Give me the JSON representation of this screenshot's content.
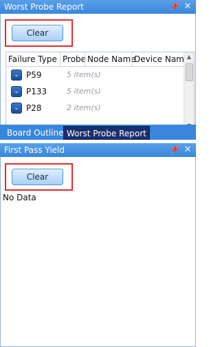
{
  "panels": {
    "worst_probe": {
      "title": "Worst Probe Report",
      "pin_icon": "pin-icon",
      "close_icon": "close-icon",
      "clear_label": "Clear",
      "columns": [
        "Failure Type",
        "Probe",
        "Node Name",
        "Device Name"
      ],
      "rows": [
        {
          "label": "P59",
          "count": "5 item(s)"
        },
        {
          "label": "P133",
          "count": "5 item(s)"
        },
        {
          "label": "P28",
          "count": "2 item(s)"
        }
      ]
    },
    "first_pass_yield": {
      "title": "First Pass Yield",
      "pin_icon": "pin-icon",
      "close_icon": "close-icon",
      "clear_label": "Clear",
      "empty_text": "No Data"
    }
  },
  "tabs": [
    {
      "label": "Board Outline",
      "active": false
    },
    {
      "label": "Worst Probe Report",
      "active": true
    }
  ],
  "colors": {
    "header_blue": "#3a86dc",
    "active_tab": "#1b2e6e",
    "highlight_red": "#e32b2b"
  }
}
